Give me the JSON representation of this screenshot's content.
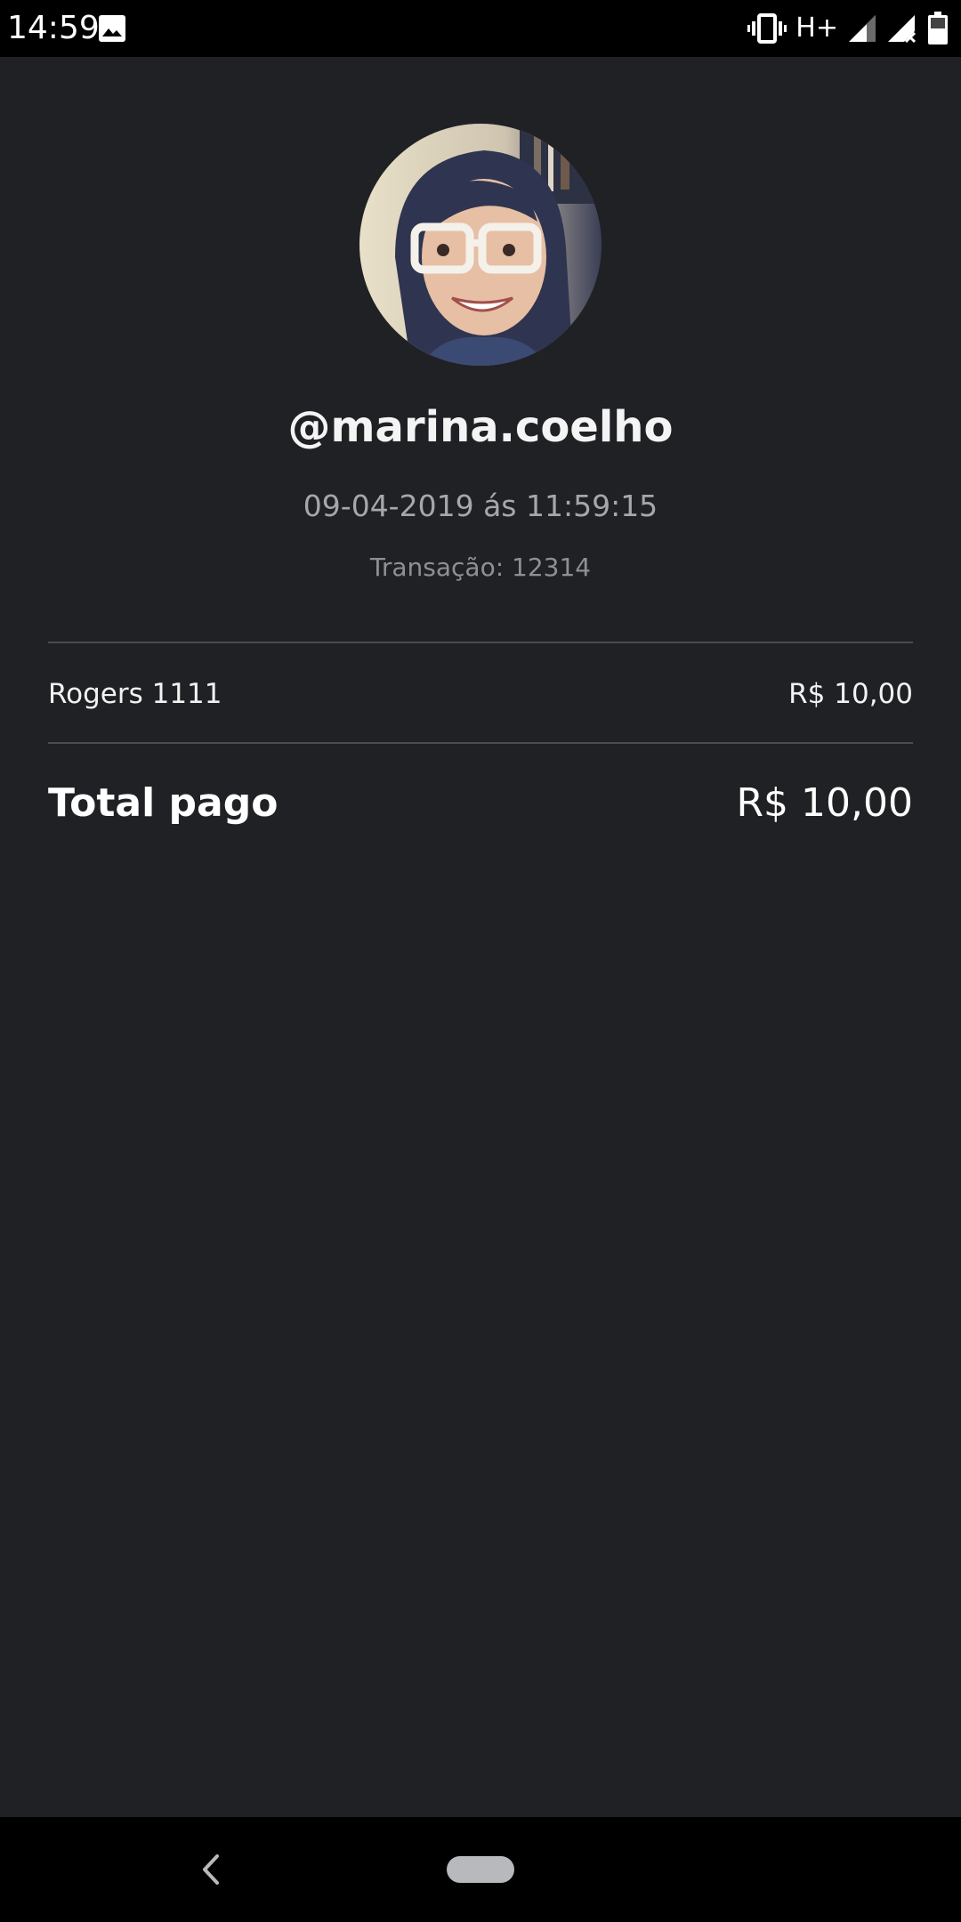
{
  "status_bar": {
    "time": "14:59",
    "network": "H+",
    "battery": "49",
    "icons": [
      "image-icon",
      "vibrate-icon",
      "signal-icon",
      "signal-no-data-icon",
      "battery-icon"
    ]
  },
  "profile": {
    "username": "@marina.coelho",
    "datetime": "09-04-2019 ás 11:59:15",
    "transaction": "Transação: 12314"
  },
  "items": [
    {
      "name": "Rogers 1111",
      "price": "R$ 10,00"
    }
  ],
  "total": {
    "label": "Total pago",
    "value": "R$ 10,00"
  },
  "colors": {
    "background": "#202125",
    "divider": "#4a4b50",
    "text_primary": "#ffffff",
    "text_secondary": "#a6a7ab"
  },
  "nav_bar": {
    "icons": [
      "back-icon",
      "home-pill-icon"
    ]
  }
}
